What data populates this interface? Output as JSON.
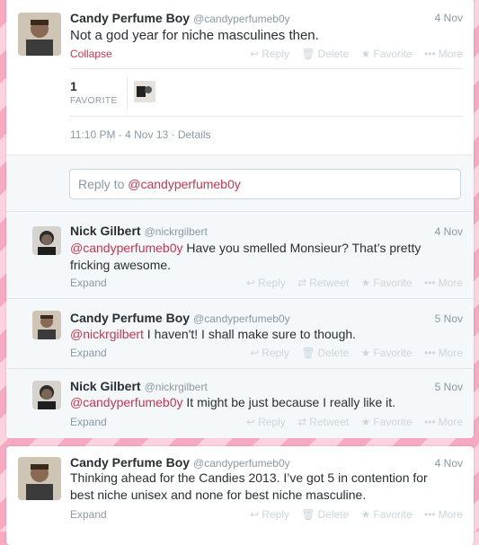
{
  "main_tweet": {
    "name": "Candy Perfume Boy",
    "handle": "@candyperfumeb0y",
    "date": "4 Nov",
    "text": "Not a god year for niche masculines then.",
    "collapse": "Collapse",
    "actions": {
      "reply": "Reply",
      "delete": "Delete",
      "favorite": "Favorite",
      "more": "More"
    },
    "favorites_count": "1",
    "favorites_label": "FAVORITE",
    "timestamp": "11:10 PM - 4 Nov 13",
    "details": "Details"
  },
  "reply_box": {
    "prefix": "Reply to",
    "mention": "@candyperfumeb0y"
  },
  "replies": [
    {
      "name": "Nick Gilbert",
      "handle": "@nickrgilbert",
      "date": "4 Nov",
      "mention": "@candyperfumeb0y",
      "text": " Have you smelled Monsieur? That’s pretty fricking awesome.",
      "expand": "Expand",
      "actions": {
        "reply": "Reply",
        "retweet": "Retweet",
        "favorite": "Favorite",
        "more": "More"
      }
    },
    {
      "name": "Candy Perfume Boy",
      "handle": "@candyperfumeb0y",
      "date": "5 Nov",
      "mention": "@nickrgilbert",
      "text": " I haven't! I shall make sure to though.",
      "expand": "Expand",
      "actions": {
        "reply": "Reply",
        "delete": "Delete",
        "favorite": "Favorite",
        "more": "More"
      }
    },
    {
      "name": "Nick Gilbert",
      "handle": "@nickrgilbert",
      "date": "5 Nov",
      "mention": "@candyperfumeb0y",
      "text": " It might be just because I really like it.",
      "expand": "Expand",
      "actions": {
        "reply": "Reply",
        "retweet": "Retweet",
        "favorite": "Favorite",
        "more": "More"
      }
    }
  ],
  "second_tweet": {
    "name": "Candy Perfume Boy",
    "handle": "@candyperfumeb0y",
    "date": "4 Nov",
    "text_line1": "Thinking ahead for the Candies 2013. I’ve got 5 in contention for",
    "text_line2": "best niche unisex and none for best niche masculine.",
    "expand": "Expand",
    "actions": {
      "reply": "Reply",
      "delete": "Delete",
      "favorite": "Favorite",
      "more": "More"
    }
  },
  "colors": {
    "accent": "#c8354f",
    "muted": "#8899a6",
    "background_stripe_a": "#f6a9c0",
    "background_stripe_b": "#fbd2de"
  }
}
